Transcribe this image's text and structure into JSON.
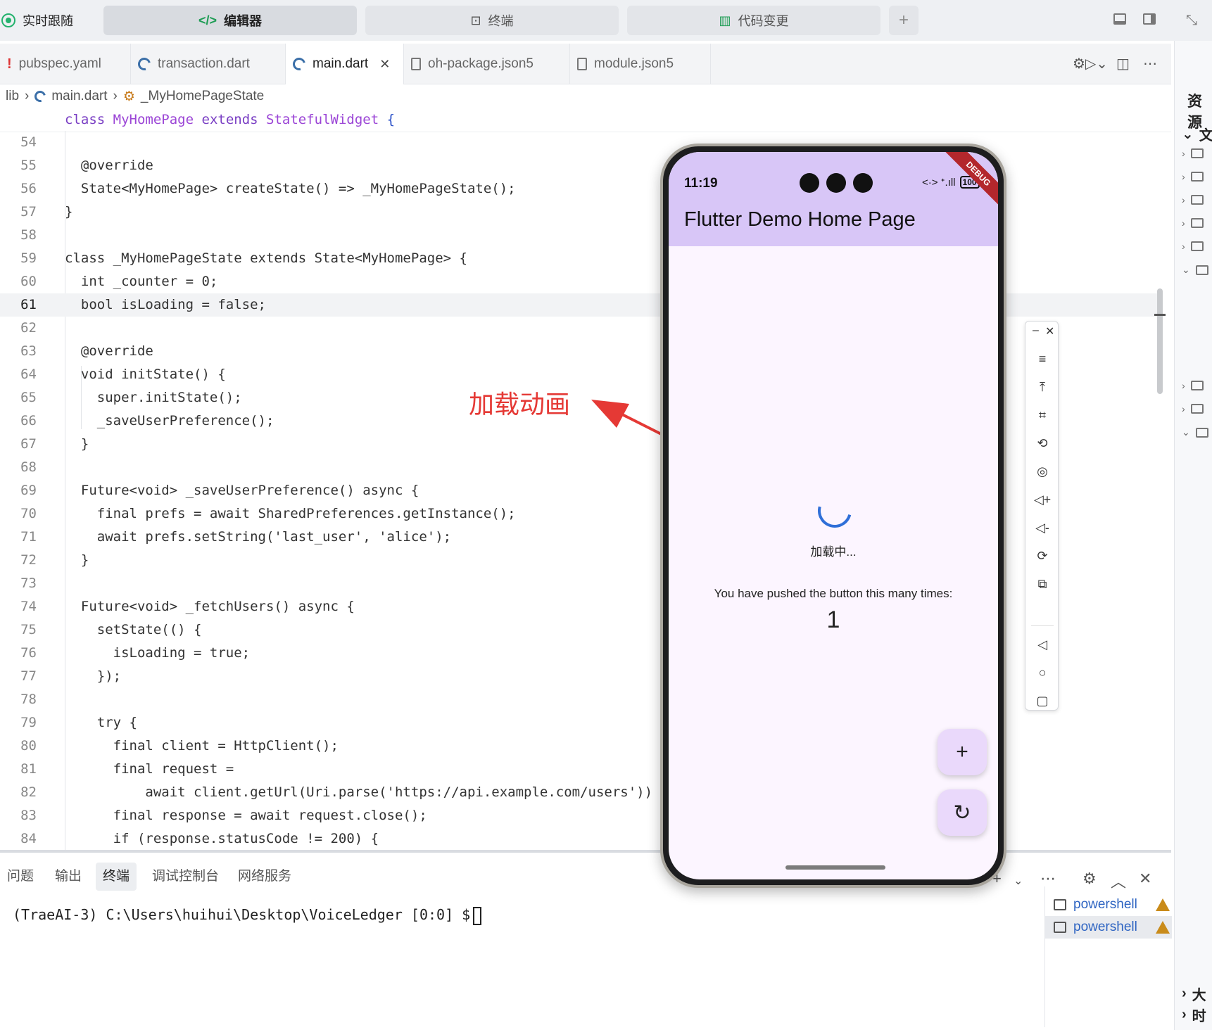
{
  "topbar": {
    "live_label": "实时跟随",
    "modes": [
      {
        "icon": "code-icon",
        "label": "编辑器"
      },
      {
        "icon": "terminal-icon",
        "label": "终端"
      },
      {
        "icon": "diff-icon",
        "label": "代码变更"
      }
    ],
    "add_label": "+"
  },
  "tabs": [
    {
      "label": "pubspec.yaml",
      "icon": "warning-icon"
    },
    {
      "label": "transaction.dart",
      "icon": "dart-icon"
    },
    {
      "label": "main.dart",
      "icon": "dart-icon",
      "active": true
    },
    {
      "label": "oh-package.json5",
      "icon": "file-icon"
    },
    {
      "label": "module.json5",
      "icon": "file-icon"
    }
  ],
  "breadcrumb": [
    "lib",
    "main.dart",
    "_MyHomePageState"
  ],
  "sticky_line": "class MyHomePage extends StatefulWidget {",
  "code_lines": [
    {
      "n": "54",
      "t": ""
    },
    {
      "n": "55",
      "t": "  @override"
    },
    {
      "n": "56",
      "t": "  State<MyHomePage> createState() => _MyHomePageState();"
    },
    {
      "n": "57",
      "t": "}"
    },
    {
      "n": "58",
      "t": ""
    },
    {
      "n": "59",
      "t": "class _MyHomePageState extends State<MyHomePage> {"
    },
    {
      "n": "60",
      "t": "  int _counter = 0;"
    },
    {
      "n": "61",
      "t": "  bool isLoading = false;"
    },
    {
      "n": "62",
      "t": ""
    },
    {
      "n": "63",
      "t": "  @override"
    },
    {
      "n": "64",
      "t": "  void initState() {"
    },
    {
      "n": "65",
      "t": "    super.initState();"
    },
    {
      "n": "66",
      "t": "    _saveUserPreference();"
    },
    {
      "n": "67",
      "t": "  }"
    },
    {
      "n": "68",
      "t": ""
    },
    {
      "n": "69",
      "t": "  Future<void> _saveUserPreference() async {"
    },
    {
      "n": "70",
      "t": "    final prefs = await SharedPreferences.getInstance();"
    },
    {
      "n": "71",
      "t": "    await prefs.setString('last_user', 'alice');"
    },
    {
      "n": "72",
      "t": "  }"
    },
    {
      "n": "73",
      "t": ""
    },
    {
      "n": "74",
      "t": "  Future<void> _fetchUsers() async {"
    },
    {
      "n": "75",
      "t": "    setState(() {"
    },
    {
      "n": "76",
      "t": "      isLoading = true;"
    },
    {
      "n": "77",
      "t": "    });"
    },
    {
      "n": "78",
      "t": ""
    },
    {
      "n": "79",
      "t": "    try {"
    },
    {
      "n": "80",
      "t": "      final client = HttpClient();"
    },
    {
      "n": "81",
      "t": "      final request ="
    },
    {
      "n": "82",
      "t": "          await client.getUrl(Uri.parse('https://api.example.com/users'))"
    },
    {
      "n": "83",
      "t": "      final response = await request.close();"
    },
    {
      "n": "84",
      "t": "      if (response.statusCode != 200) {"
    }
  ],
  "current_line": "61",
  "annotation": "加载动画",
  "phone": {
    "time": "11:19",
    "status": "<·> ᐩ.ıll",
    "battery": "100",
    "debug_banner": "DEBUG",
    "app_title": "Flutter Demo Home Page",
    "loading_text": "加载中...",
    "push_message": "You have pushed the button this many times:",
    "counter": "1",
    "fab_add": "+",
    "fab_refresh": "↻"
  },
  "panel": {
    "tabs": [
      "问题",
      "输出",
      "终端",
      "调试控制台",
      "网络服务"
    ],
    "active_tab": "终端",
    "prompt": "(TraeAI-3) C:\\Users\\huihui\\Desktop\\VoiceLedger [0:0] $",
    "shells": [
      "powershell",
      "powershell"
    ]
  },
  "sidebar": {
    "title": "资源",
    "subtitle": "文",
    "bottom_items": [
      "大",
      "时"
    ]
  },
  "colors": {
    "accent": "#2f6fd8",
    "appbar": "#d8c6f7",
    "annotation": "#e53935",
    "live": "#23b26d"
  }
}
